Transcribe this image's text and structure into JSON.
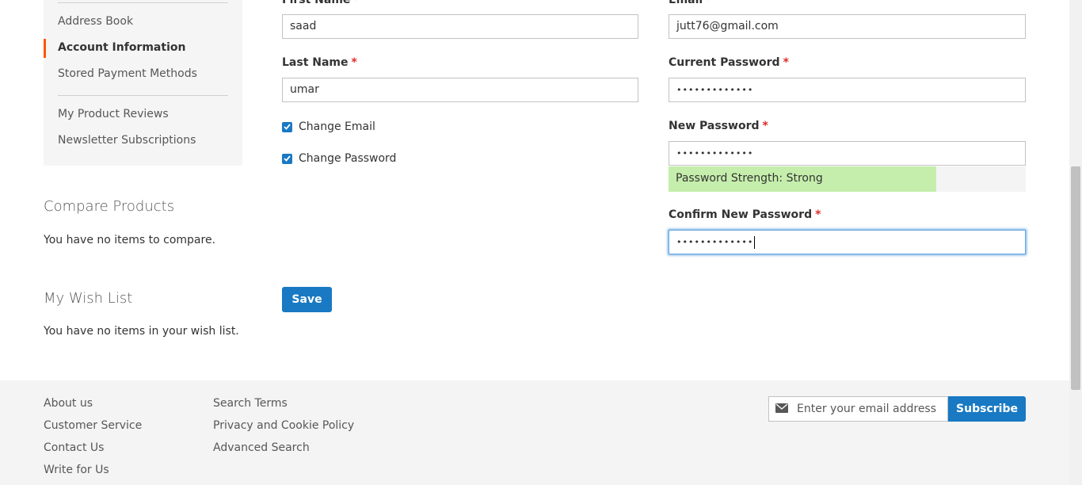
{
  "sidebar": {
    "items": [
      {
        "label": "Address Book",
        "active": false
      },
      {
        "label": "Account Information",
        "active": true
      },
      {
        "label": "Stored Payment Methods",
        "active": false
      },
      {
        "label": "My Product Reviews",
        "active": false
      },
      {
        "label": "Newsletter Subscriptions",
        "active": false
      }
    ],
    "accent_color": "#ff5501"
  },
  "compare": {
    "title": "Compare Products",
    "empty_text": "You have no items to compare."
  },
  "wishlist": {
    "title": "My Wish List",
    "empty_text": "You have no items in your wish list."
  },
  "form": {
    "first_name": {
      "label": "First Name",
      "value": "saad"
    },
    "last_name": {
      "label": "Last Name",
      "value": "umar"
    },
    "email": {
      "label": "Email",
      "value": "jutt76@gmail.com"
    },
    "current_password": {
      "label": "Current Password",
      "value": "•••••••••••••"
    },
    "new_password": {
      "label": "New Password",
      "value": "•••••••••••••"
    },
    "confirm_password": {
      "label": "Confirm New Password",
      "value": "•••••••••••••"
    },
    "required_marker": "*",
    "change_email": {
      "label": "Change Email",
      "checked": true
    },
    "change_password": {
      "label": "Change Password",
      "checked": true
    },
    "password_strength": {
      "text": "Password Strength: Strong",
      "fill_fraction": 0.75,
      "color": "#c5eeac"
    },
    "save_label": "Save"
  },
  "footer": {
    "col1": [
      "About us",
      "Customer Service",
      "Contact Us",
      "Write for Us"
    ],
    "col2": [
      "Search Terms",
      "Privacy and Cookie Policy",
      "Advanced Search"
    ],
    "newsletter": {
      "placeholder": "Enter your email address",
      "button_label": "Subscribe",
      "icon": "envelope-icon"
    }
  },
  "colors": {
    "primary": "#1979c3",
    "required": "#e02b27"
  }
}
